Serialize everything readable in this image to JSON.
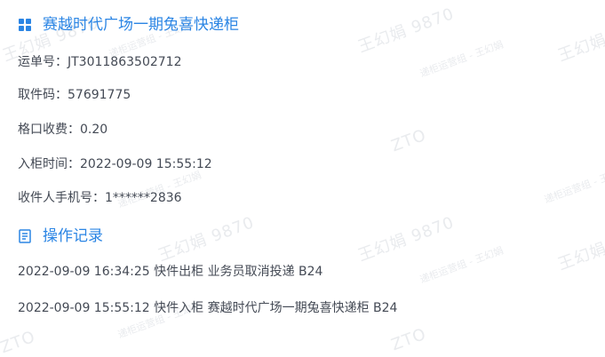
{
  "locker_section": {
    "icon": "grid-icon",
    "title": "赛越时代广场一期兔喜快递柜"
  },
  "fields": [
    {
      "label": "运单号：",
      "value": "JT3011863502712"
    },
    {
      "label": "取件码：",
      "value": "57691775"
    },
    {
      "label": "格口收费：",
      "value": "0.20"
    },
    {
      "label": "入柜时间：",
      "value": "2022-09-09 15:55:12"
    },
    {
      "label": "收件人手机号：",
      "value": "1******2836"
    }
  ],
  "log_section": {
    "icon": "list-document-icon",
    "title": "操作记录"
  },
  "logs": [
    {
      "text": "2022-09-09 16:34:25 快件出柜 业务员取消投递 B24"
    },
    {
      "text": "2022-09-09 15:55:12 快件入柜 赛越时代广场一期兔喜快递柜 B24"
    }
  ],
  "watermark": {
    "name": "王幻娟 9870",
    "org": "递柜运营组 - 王幻娟",
    "brand": "ZTO"
  },
  "colors": {
    "accent": "#2b85e4",
    "text": "#444a55",
    "watermark": "#e9ebee"
  }
}
